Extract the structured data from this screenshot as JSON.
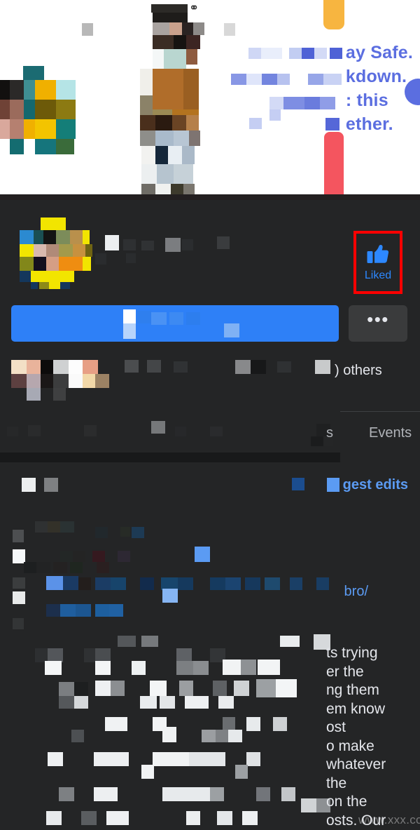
{
  "cover": {
    "text_lines": [
      "ay Safe.",
      "kdown.",
      ": this",
      "ether."
    ],
    "doodle_icon": "scribble-icon"
  },
  "profile": {
    "liked_button": {
      "label": "Liked",
      "icon": "thumbs-up-icon",
      "highlight_color": "#ff0000",
      "accent_color": "#2d88ff"
    },
    "primary_action": {
      "label": "",
      "color": "#2e80f7"
    },
    "more_button": {
      "label": "•••",
      "icon": "ellipsis-icon"
    },
    "likes_summary": ") others"
  },
  "tabs": [
    {
      "label": "s"
    },
    {
      "label": "Events"
    }
  ],
  "about": {
    "suggest_edits_label": "gest edits",
    "website_label": "bro/"
  },
  "post": {
    "lines": [
      "ts trying",
      "er the",
      "ng them",
      "em know",
      "ost",
      "o make",
      "whatever",
      "the",
      "on the",
      "osts. Our"
    ]
  },
  "watermark": {
    "text": "www.xxx.com"
  }
}
